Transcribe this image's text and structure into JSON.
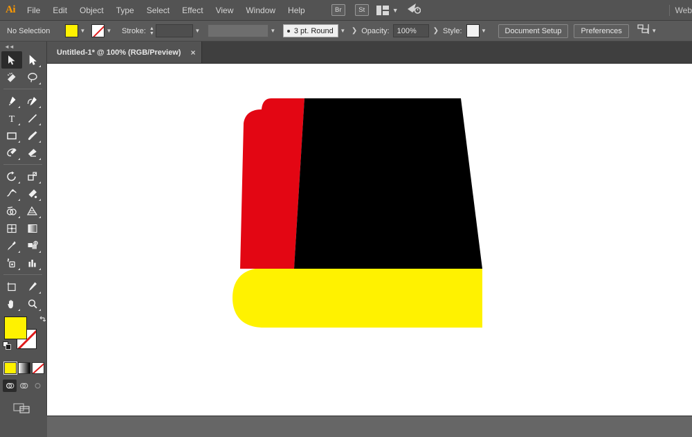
{
  "app": {
    "logo": "Ai",
    "workspace_name": "Web"
  },
  "menubar": {
    "items": [
      {
        "label": "File",
        "name": "menu-file"
      },
      {
        "label": "Edit",
        "name": "menu-edit"
      },
      {
        "label": "Object",
        "name": "menu-object"
      },
      {
        "label": "Type",
        "name": "menu-type"
      },
      {
        "label": "Select",
        "name": "menu-select"
      },
      {
        "label": "Effect",
        "name": "menu-effect"
      },
      {
        "label": "View",
        "name": "menu-view"
      },
      {
        "label": "Window",
        "name": "menu-window"
      },
      {
        "label": "Help",
        "name": "menu-help"
      }
    ],
    "bridge_label": "Br",
    "stock_label": "St",
    "arrange_icon": "arrange-documents-icon",
    "search_icon": "search-adobe-stock-icon",
    "workspace_switcher_icon": "workspace-switcher-icon"
  },
  "controlbar": {
    "selection_status": "No Selection",
    "fill_color": "#FFF200",
    "fill_swatch_name": "fill-color-swatch",
    "stroke_color": "None",
    "stroke_swatch_name": "stroke-color-swatch",
    "stroke_label": "Stroke:",
    "stroke_weight": "",
    "variable_width_profile": "",
    "brush_definition": "3 pt. Round",
    "opacity_label": "Opacity:",
    "opacity_value": "100%",
    "style_label": "Style:",
    "style_swatch_color": "#f2f2f2",
    "document_setup_label": "Document Setup",
    "preferences_label": "Preferences",
    "align_icon": "align-objects-icon"
  },
  "tabbar": {
    "document_tab_title": "Untitled-1* @ 100% (RGB/Preview)",
    "close_label": "×"
  },
  "toolpanel": {
    "collapse_icon": "collapse-panel-icon",
    "tools": [
      {
        "name": "selection-tool",
        "active": true
      },
      {
        "name": "direct-selection-tool",
        "active": false
      },
      {
        "name": "magic-wand-tool",
        "active": false
      },
      {
        "name": "lasso-tool",
        "active": false
      },
      {
        "name": "pen-tool",
        "active": false
      },
      {
        "name": "curvature-tool",
        "active": false
      },
      {
        "name": "type-tool",
        "active": false
      },
      {
        "name": "line-segment-tool",
        "active": false
      },
      {
        "name": "rectangle-tool",
        "active": false
      },
      {
        "name": "paintbrush-tool",
        "active": false
      },
      {
        "name": "shaper-tool",
        "active": false
      },
      {
        "name": "eraser-tool",
        "active": false
      },
      {
        "name": "rotate-tool",
        "active": false
      },
      {
        "name": "scale-tool",
        "active": false
      },
      {
        "name": "width-tool",
        "active": false
      },
      {
        "name": "free-transform-tool",
        "active": false
      },
      {
        "name": "shape-builder-tool",
        "active": false
      },
      {
        "name": "perspective-grid-tool",
        "active": false
      },
      {
        "name": "mesh-tool",
        "active": false
      },
      {
        "name": "gradient-tool",
        "active": false
      },
      {
        "name": "eyedropper-tool",
        "active": false
      },
      {
        "name": "blend-tool",
        "active": false
      },
      {
        "name": "symbol-sprayer-tool",
        "active": false
      },
      {
        "name": "column-graph-tool",
        "active": false
      },
      {
        "name": "artboard-tool",
        "active": false
      },
      {
        "name": "slice-tool",
        "active": false
      },
      {
        "name": "hand-tool",
        "active": false
      },
      {
        "name": "zoom-tool",
        "active": false
      }
    ],
    "fill_color": "#FFF200",
    "stroke_color": "None",
    "swap_fill_stroke_icon": "swap-fill-stroke-icon",
    "default_fill_stroke_icon": "default-fill-stroke-icon",
    "color_mode_button": "color-mode-button",
    "gradient_mode_button": "gradient-mode-button",
    "none_mode_button": "none-mode-button",
    "draw_normal_button": "draw-normal-button",
    "draw_behind_button": "draw-behind-button",
    "draw_inside_button": "draw-inside-button",
    "screen_mode_button": "change-screen-mode-button"
  },
  "artwork": {
    "title": "book-illustration",
    "spine_color": "#E30613",
    "cover_color": "#000000",
    "pages_color": "#FFF200",
    "background_color": "#FFFFFF"
  }
}
